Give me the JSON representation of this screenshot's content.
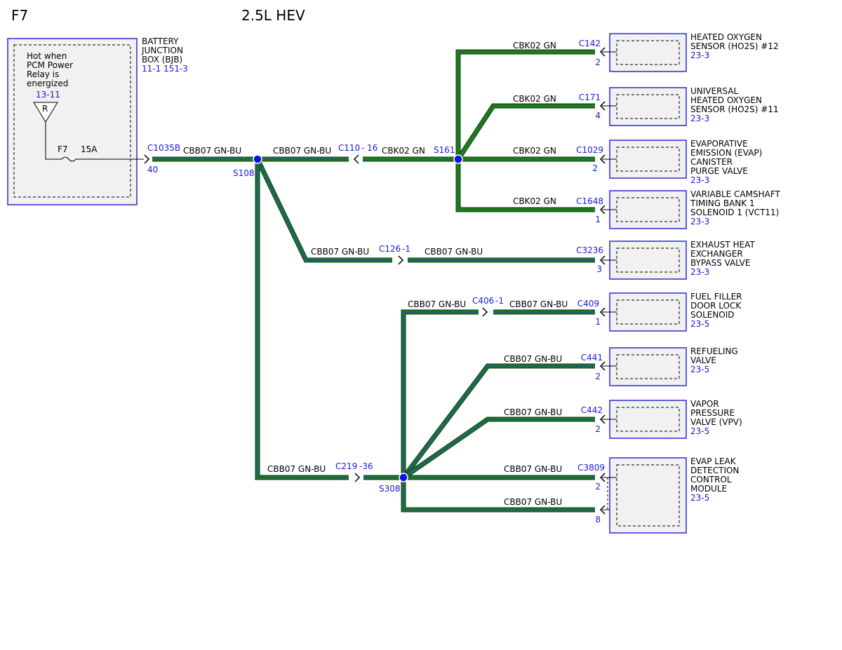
{
  "page_code": "F7",
  "title": "2.5L HEV",
  "colors": {
    "box_border": "#2b2bd0",
    "box_fill": "#f1f1f1",
    "ref_blue": "#1a1ad6",
    "wire_green": "#1e7a1e",
    "wire_blue_stripe": "#1f4fb0",
    "splice": "#1010e0"
  },
  "bjb": {
    "note_lines": [
      "Hot when",
      "PCM Power",
      "Relay is",
      "energized"
    ],
    "relay_ref": "13-11",
    "relay_label": "R",
    "fuse_label": "F7",
    "fuse_rating": "15A",
    "name_lines": [
      "BATTERY",
      "JUNCTION",
      "BOX (BJB)"
    ],
    "refs": "11-1   151-3"
  },
  "connectors": [
    {
      "id": "c1035b",
      "label": "C1035B",
      "pin": "40"
    },
    {
      "id": "c110",
      "label": "C110",
      "pin": "- 16"
    },
    {
      "id": "c126",
      "label": "C126",
      "pin": "-1"
    },
    {
      "id": "c219",
      "label": "C219",
      "pin": "-36"
    },
    {
      "id": "c406",
      "label": "C406",
      "pin": "-1"
    },
    {
      "id": "c142",
      "label": "C142",
      "pin": "2"
    },
    {
      "id": "c171",
      "label": "C171",
      "pin": "4"
    },
    {
      "id": "c1029",
      "label": "C1029",
      "pin": "2"
    },
    {
      "id": "c1648",
      "label": "C1648",
      "pin": "1"
    },
    {
      "id": "c3236",
      "label": "C3236",
      "pin": "3"
    },
    {
      "id": "c409",
      "label": "C409",
      "pin": "1"
    },
    {
      "id": "c441",
      "label": "C441",
      "pin": "2"
    },
    {
      "id": "c442",
      "label": "C442",
      "pin": "2"
    },
    {
      "id": "c3809",
      "label": "C3809",
      "pin": "2"
    },
    {
      "id": "c3809b",
      "label": "",
      "pin": "8"
    }
  ],
  "splices": [
    {
      "id": "s108",
      "label": "S108"
    },
    {
      "id": "s161",
      "label": "S161"
    },
    {
      "id": "s308",
      "label": "S308"
    }
  ],
  "wires": [
    {
      "id": "w1",
      "label": "CBB07   GN-BU"
    },
    {
      "id": "w2",
      "label": "CBB07   GN-BU"
    },
    {
      "id": "w3",
      "label": "CBK02   GN"
    },
    {
      "id": "w4",
      "label": "CBK02   GN"
    },
    {
      "id": "w5",
      "label": "CBK02   GN"
    },
    {
      "id": "w6",
      "label": "CBK02   GN"
    },
    {
      "id": "w7",
      "label": "CBK02   GN"
    },
    {
      "id": "w8",
      "label": "CBB07   GN-BU"
    },
    {
      "id": "w9",
      "label": "CBB07   GN-BU"
    },
    {
      "id": "w10",
      "label": "CBB07   GN-BU"
    },
    {
      "id": "w11",
      "label": "CBB07   GN-BU"
    },
    {
      "id": "w12",
      "label": "CBB07   GN-BU"
    },
    {
      "id": "w13",
      "label": "CBB07   GN-BU"
    },
    {
      "id": "w14",
      "label": "CBB07   GN-BU"
    },
    {
      "id": "w15",
      "label": "CBB07   GN-BU"
    },
    {
      "id": "w16",
      "label": "CBB07   GN-BU"
    }
  ],
  "components": [
    {
      "id": "ho2s12",
      "name_lines": [
        "HEATED OXYGEN",
        "SENSOR (HO2S) #12"
      ],
      "ref": "23-3"
    },
    {
      "id": "uho2s11",
      "name_lines": [
        "UNIVERSAL",
        "HEATED OXYGEN",
        "SENSOR (HO2S) #11"
      ],
      "ref": "23-3"
    },
    {
      "id": "evap",
      "name_lines": [
        "EVAPORATIVE",
        "EMISSION (EVAP)",
        "CANISTER",
        "PURGE VALVE"
      ],
      "ref": "23-3"
    },
    {
      "id": "vct",
      "name_lines": [
        "VARIABLE CAMSHAFT",
        "TIMING BANK 1",
        "SOLENOID 1 (VCT11)"
      ],
      "ref": "23-3"
    },
    {
      "id": "exhaust",
      "name_lines": [
        "EXHAUST HEAT",
        "EXCHANGER",
        "BYPASS VALVE"
      ],
      "ref": "23-3"
    },
    {
      "id": "fuel",
      "name_lines": [
        "FUEL FILLER",
        "DOOR LOCK",
        "SOLENOID"
      ],
      "ref": "23-5"
    },
    {
      "id": "refuel",
      "name_lines": [
        "REFUELING",
        "VALVE"
      ],
      "ref": "23-5"
    },
    {
      "id": "vpv",
      "name_lines": [
        "VAPOR",
        "PRESSURE",
        "VALVE (VPV)"
      ],
      "ref": "23-5"
    },
    {
      "id": "leak",
      "name_lines": [
        "EVAP LEAK",
        "DETECTION",
        "CONTROL",
        "MODULE"
      ],
      "ref": "23-5"
    }
  ]
}
